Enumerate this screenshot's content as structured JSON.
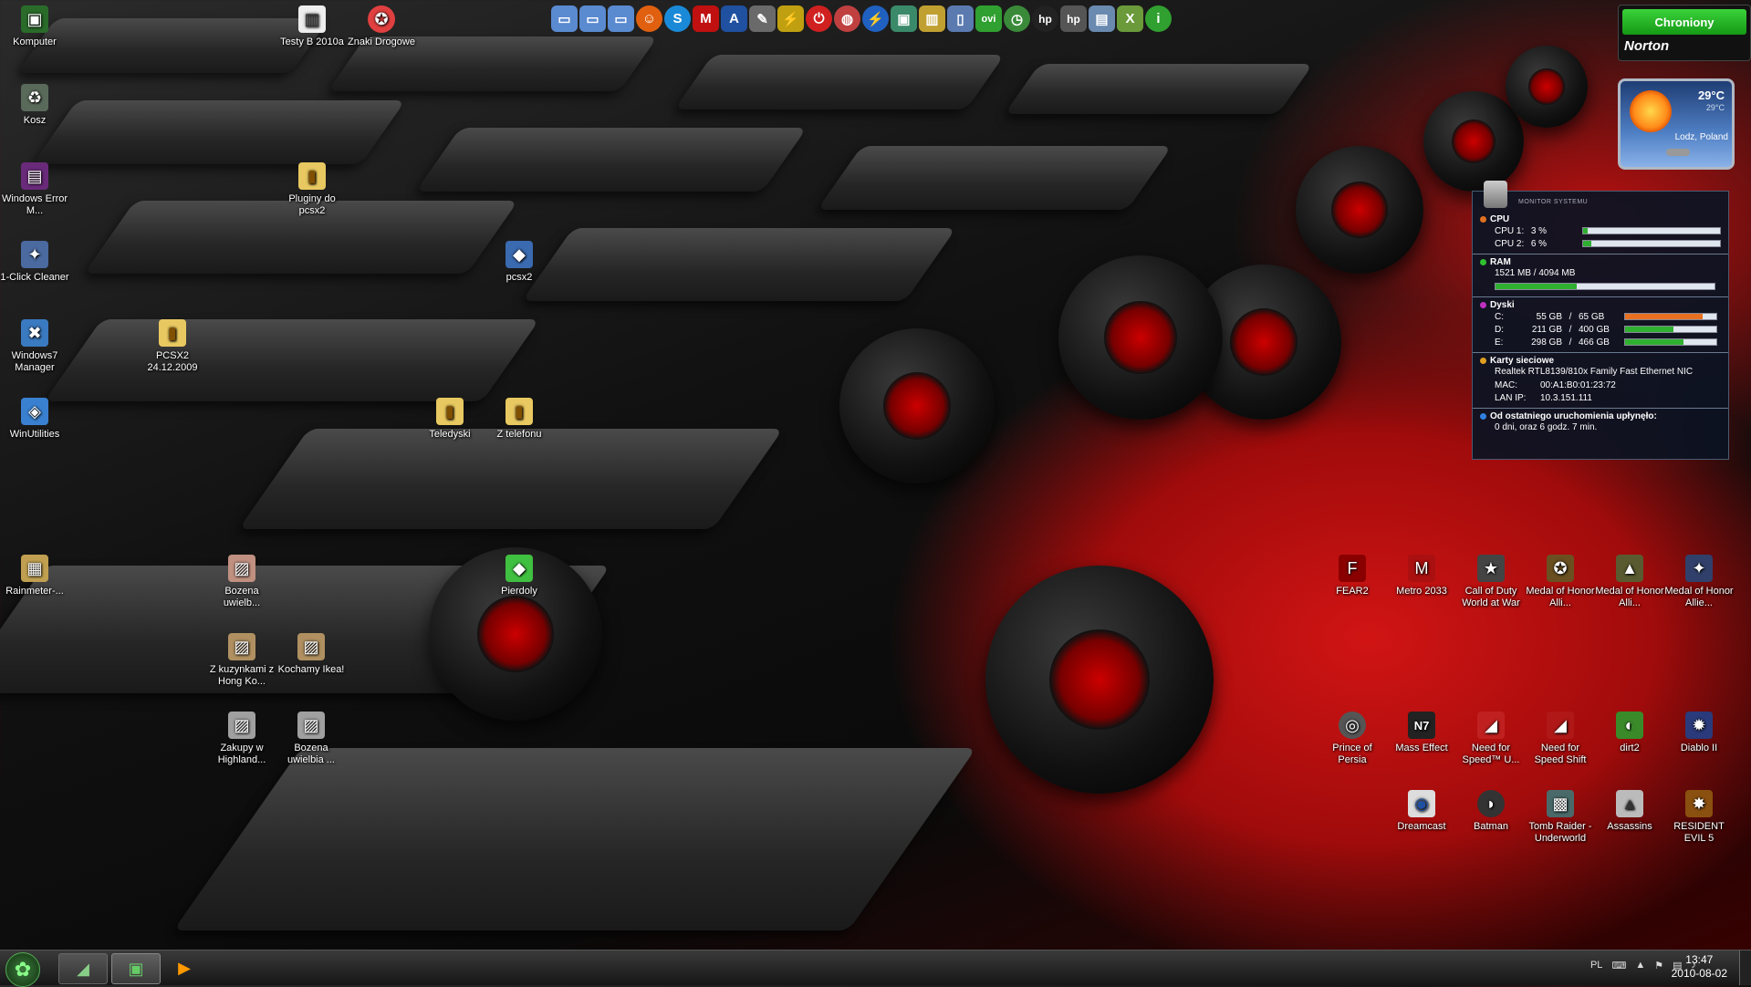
{
  "desktop_left": [
    {
      "label": "Komputer",
      "icon": "computer-icon",
      "glyph": "▣",
      "color": "#2a6b2a"
    },
    {
      "label": "Kosz",
      "icon": "recycle-bin-icon",
      "glyph": "♻",
      "color": "#5a6a5a"
    },
    {
      "label": "Windows Error M...",
      "icon": "winrar-icon",
      "glyph": "▤",
      "color": "#6a2a7a"
    },
    {
      "label": "1-Click Cleaner",
      "icon": "cleaner-icon",
      "glyph": "✦",
      "color": "#4a6aa0"
    },
    {
      "label": "Windows7 Manager",
      "icon": "windows7-manager-icon",
      "glyph": "✖",
      "color": "#3a7ac0"
    },
    {
      "label": "WinUtilities",
      "icon": "winutilities-icon",
      "glyph": "◈",
      "color": "#3a80d0"
    },
    {
      "label": "Rainmeter-...",
      "icon": "rainmeter-file-icon",
      "glyph": "▦",
      "color": "#c0a050"
    }
  ],
  "desktop_misc": [
    {
      "label": "Testy B 2010a",
      "icon": "testy-icon",
      "glyph": "▥",
      "color": "#eee"
    },
    {
      "label": "Znaki Drogowe",
      "icon": "road-signs-icon",
      "glyph": "✪",
      "color": "#e04040"
    },
    {
      "label": "Pluginy do pcsx2",
      "icon": "folder-icon",
      "glyph": "▮",
      "color": "#e8c860"
    },
    {
      "label": "pcsx2",
      "icon": "pcsx2-icon",
      "glyph": "◆",
      "color": "#3a6ab0"
    },
    {
      "label": "PCSX2 24.12.2009",
      "icon": "folder-icon",
      "glyph": "▮",
      "color": "#e8c860"
    },
    {
      "label": "Teledyski",
      "icon": "folder-icon",
      "glyph": "▮",
      "color": "#e8c860"
    },
    {
      "label": "Z telefonu",
      "icon": "folder-icon",
      "glyph": "▮",
      "color": "#e8c860"
    },
    {
      "label": "Bozena uwielb...",
      "icon": "photo-icon",
      "glyph": "▨",
      "color": "#c09080"
    },
    {
      "label": "Pierdoly",
      "icon": "green-folder-icon",
      "glyph": "◆",
      "color": "#40c040"
    },
    {
      "label": "Z kuzynkami z Hong Ko...",
      "icon": "photo-icon",
      "glyph": "▨",
      "color": "#b09060"
    },
    {
      "label": "Kochamy Ikea!",
      "icon": "photo-icon",
      "glyph": "▨",
      "color": "#b09060"
    },
    {
      "label": "Zakupy w Highland...",
      "icon": "photo-icon",
      "glyph": "▨",
      "color": "#a0a0a0"
    },
    {
      "label": "Bozena uwielbia ...",
      "icon": "photo-icon",
      "glyph": "▨",
      "color": "#a0a0a0"
    }
  ],
  "games_row1": [
    {
      "label": "FEAR2",
      "icon": "fear2-icon",
      "glyph": "F",
      "color": "#8a0000"
    },
    {
      "label": "Metro 2033",
      "icon": "metro2033-icon",
      "glyph": "M",
      "color": "#aa1010"
    },
    {
      "label": "Call of Duty World at War",
      "icon": "cod-icon",
      "glyph": "★",
      "color": "#444"
    },
    {
      "label": "Medal of Honor Alli...",
      "icon": "moh-icon",
      "glyph": "✪",
      "color": "#6a5020"
    },
    {
      "label": "Medal of Honor Alli...",
      "icon": "moh-icon",
      "glyph": "▲",
      "color": "#5a5a30"
    },
    {
      "label": "Medal of Honor Allie...",
      "icon": "moh-icon",
      "glyph": "✦",
      "color": "#30406a"
    }
  ],
  "games_row2": [
    {
      "label": "Prince of Persia",
      "icon": "pop-icon",
      "glyph": "◎",
      "color": "#555"
    },
    {
      "label": "Mass Effect",
      "icon": "mass-effect-icon",
      "glyph": "N7",
      "color": "#222"
    },
    {
      "label": "Need for Speed™ U...",
      "icon": "nfs-icon",
      "glyph": "◢",
      "color": "#c02020"
    },
    {
      "label": "Need for Speed Shift",
      "icon": "nfs-shift-icon",
      "glyph": "◢",
      "color": "#b01818"
    },
    {
      "label": "dirt2",
      "icon": "dirt2-icon",
      "glyph": "◐",
      "color": "#3a8a2a"
    },
    {
      "label": "Diablo II",
      "icon": "diablo-icon",
      "glyph": "✹",
      "color": "#2a3a7a"
    }
  ],
  "games_row3": [
    {
      "label": "Dreamcast",
      "icon": "dreamcast-icon",
      "glyph": "◉",
      "color": "#ddd"
    },
    {
      "label": "Batman",
      "icon": "batman-icon",
      "glyph": "◗",
      "color": "#333"
    },
    {
      "label": "Tomb Raider - Underworld",
      "icon": "tomb-raider-icon",
      "glyph": "▩",
      "color": "#4a6a6a"
    },
    {
      "label": "Assassins",
      "icon": "assassins-icon",
      "glyph": "▲",
      "color": "#bbb"
    },
    {
      "label": "RESIDENT EVIL 5",
      "icon": "re5-icon",
      "glyph": "✸",
      "color": "#8a5010"
    }
  ],
  "toolbar_icons": [
    {
      "icon": "folder-blue-icon",
      "glyph": "▭",
      "color": "#5a8ad0"
    },
    {
      "icon": "folder-blue-icon",
      "glyph": "▭",
      "color": "#5a8ad0"
    },
    {
      "icon": "folder-blue-icon",
      "glyph": "▭",
      "color": "#5a8ad0"
    },
    {
      "icon": "smiley-icon",
      "glyph": "☺",
      "color": "#e06010"
    },
    {
      "icon": "skype-icon",
      "glyph": "S",
      "color": "#1a8ad8"
    },
    {
      "icon": "mcafee-icon",
      "glyph": "M",
      "color": "#c01010"
    },
    {
      "icon": "a-icon",
      "glyph": "A",
      "color": "#2050a0"
    },
    {
      "icon": "tool-icon",
      "glyph": "✎",
      "color": "#6a6a6a"
    },
    {
      "icon": "lightning-icon",
      "glyph": "⚡",
      "color": "#c0a010"
    },
    {
      "icon": "power-icon",
      "glyph": "⏻",
      "color": "#d02020"
    },
    {
      "icon": "globe-icon",
      "glyph": "◍",
      "color": "#c04040"
    },
    {
      "icon": "bolt-icon",
      "glyph": "⚡",
      "color": "#2060c0"
    },
    {
      "icon": "monitor-icon",
      "glyph": "▣",
      "color": "#3a8a6a"
    },
    {
      "icon": "chart-icon",
      "glyph": "▥",
      "color": "#c0a030"
    },
    {
      "icon": "phone-icon",
      "glyph": "▯",
      "color": "#5a7ab0"
    },
    {
      "icon": "ovi-icon",
      "glyph": "ovi",
      "color": "#30a030"
    },
    {
      "icon": "clock-icon",
      "glyph": "◷",
      "color": "#3a8a3a"
    },
    {
      "icon": "hp-icon",
      "glyph": "hp",
      "color": "#222"
    },
    {
      "icon": "hp-icon",
      "glyph": "hp",
      "color": "#555"
    },
    {
      "icon": "window-icon",
      "glyph": "▤",
      "color": "#6a8ab0"
    },
    {
      "icon": "xbox-icon",
      "glyph": "X",
      "color": "#6a9a3a"
    },
    {
      "icon": "info-icon",
      "glyph": "i",
      "color": "#30a030"
    }
  ],
  "norton": {
    "status": "Chroniony",
    "brand": "Norton",
    "color": "#22b022"
  },
  "weather": {
    "temp": "29°C",
    "temp_small": "29°C",
    "location": "Lodz, Poland"
  },
  "monitor": {
    "title": "MONITOR SYSTEMU",
    "cpu_title": "CPU",
    "cpu": [
      {
        "k": "CPU 1:",
        "v": "3 %",
        "pct": 3
      },
      {
        "k": "CPU 2:",
        "v": "6 %",
        "pct": 6
      }
    ],
    "ram_title": "RAM",
    "ram_text": "1521 MB / 4094 MB",
    "ram_pct": 37,
    "disk_title": "Dyski",
    "disks": [
      {
        "k": "C:",
        "used": "55 GB",
        "sep": "/",
        "total": "65 GB",
        "pct": 85,
        "color": "#e87020"
      },
      {
        "k": "D:",
        "used": "211 GB",
        "sep": "/",
        "total": "400 GB",
        "pct": 53,
        "color": "#30b030"
      },
      {
        "k": "E:",
        "used": "298 GB",
        "sep": "/",
        "total": "466 GB",
        "pct": 64,
        "color": "#30b030"
      }
    ],
    "net_title": "Karty sieciowe",
    "net_card": "Realtek RTL8139/810x Family Fast Ethernet NIC",
    "net_mac_k": "MAC:",
    "net_mac": "00:A1:B0:01:23:72",
    "net_ip_k": "LAN IP:",
    "net_ip": "10.3.151.111",
    "uptime_title": "Od ostatniego uruchomienia upłynęło:",
    "uptime": "0 dni, oraz 6 godz. 7 min."
  },
  "taskbar": {
    "lang": "PL",
    "time": "13:47",
    "date": "2010-08-02"
  }
}
